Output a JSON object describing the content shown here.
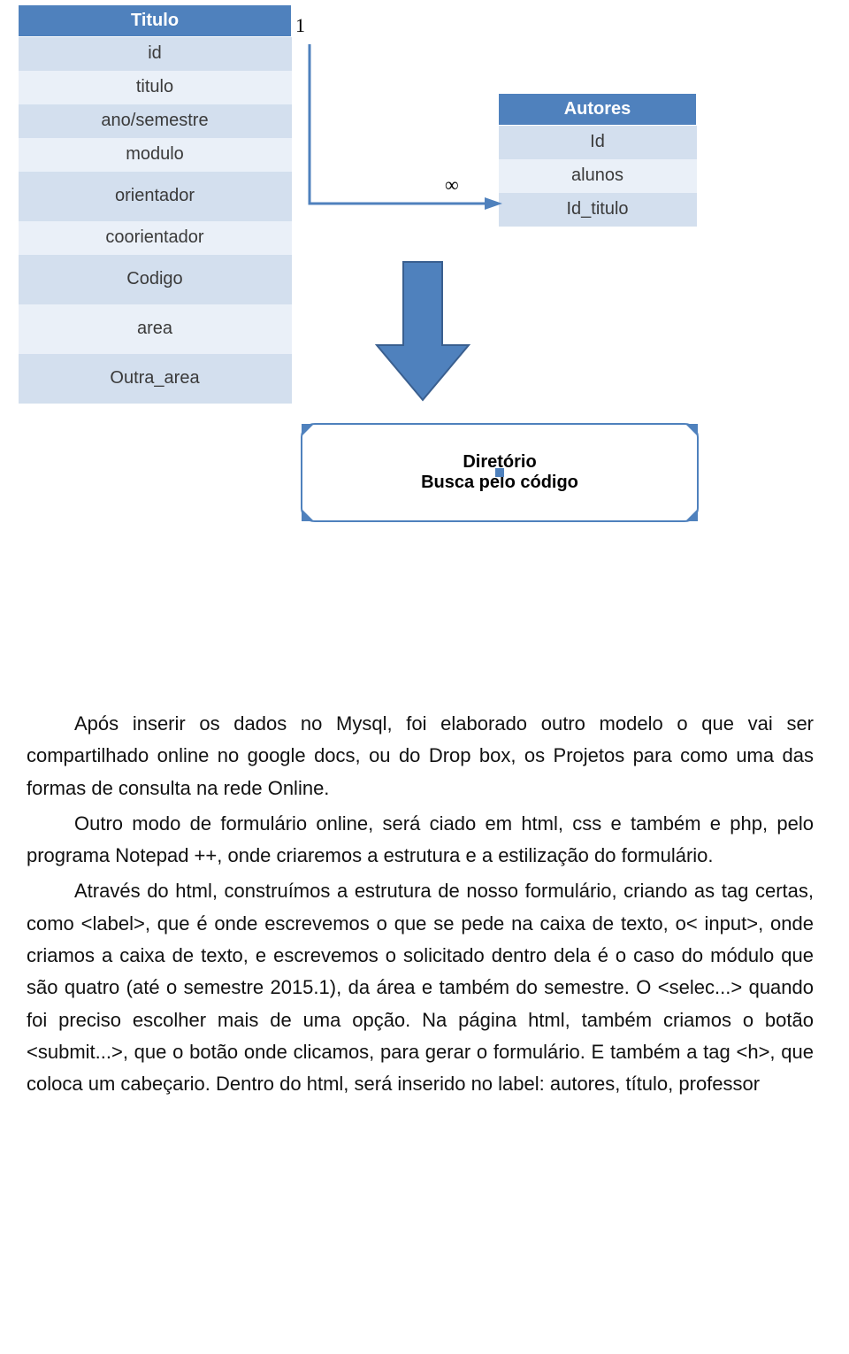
{
  "titulo_table": {
    "header": "Titulo",
    "rows": [
      "id",
      "titulo",
      "ano/semestre",
      "modulo",
      "orientador",
      "coorientador",
      "Codigo",
      "area",
      "Outra_area"
    ]
  },
  "autores_table": {
    "header": "Autores",
    "rows": [
      "Id",
      "alunos",
      "Id_titulo"
    ]
  },
  "cardinality": {
    "one": "1",
    "many": "∞"
  },
  "directory": {
    "line1": "Diretório",
    "line2": "Busca pelo código"
  },
  "paragraphs": [
    "Após inserir os dados no Mysql, foi elaborado outro modelo o que vai ser compartilhado online no google docs, ou do Drop box, os Projetos para  como uma das formas de consulta na rede Online.",
    "Outro modo de formulário online, será ciado em html, css e também e php, pelo programa Notepad ++, onde criaremos a estrutura e a estilização do formulário.",
    "Através do html, construímos a estrutura de nosso formulário, criando as tag certas, como <label>, que é onde escrevemos o que se pede na caixa de texto, o< input>, onde criamos a caixa de texto, e escrevemos o solicitado dentro dela é o caso do módulo que são quatro (até o semestre 2015.1), da área e também do semestre. O <selec...>  quando foi preciso escolher mais de uma opção. Na página html, também criamos o botão <submit...>, que o botão onde clicamos, para gerar o formulário. E também a tag <h>, que coloca um cabeçario. Dentro do html, será inserido no label: autores, título,  professor"
  ]
}
